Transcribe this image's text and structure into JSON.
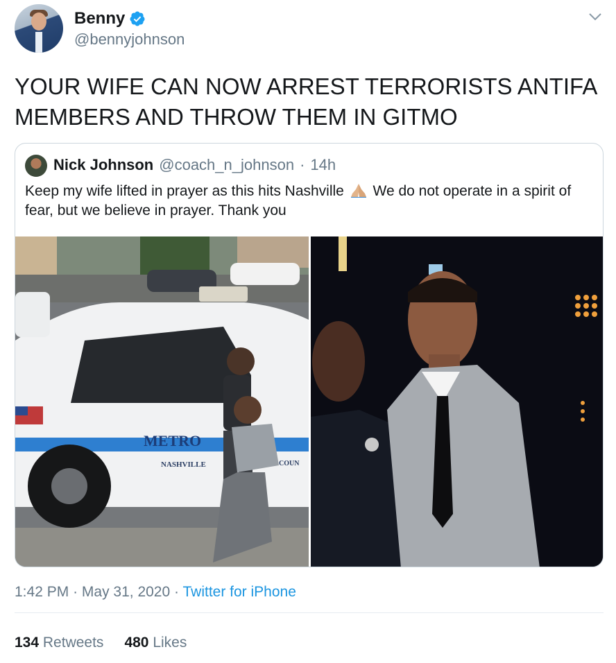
{
  "author": {
    "display_name": "Benny",
    "handle": "@bennyjohnson",
    "verified": true,
    "avatar_icon": "profile-photo"
  },
  "tweet": {
    "text": "YOUR WIFE CAN NOW ARREST TERRORISTS ANTIFA MEMBERS AND THROW THEM IN GITMO"
  },
  "quoted_tweet": {
    "display_name": "Nick Johnson",
    "handle": "@coach_n_johnson",
    "separator": "·",
    "time": "14h",
    "text_before_emoji": "Keep my wife lifted in prayer as this hits Nashville ",
    "emoji": "folded-hands",
    "text_after_emoji": " We do not operate in a spirit of fear, but we believe in prayer. Thank you",
    "photos": [
      "police-car-with-children-photo",
      "couple-portrait-photo"
    ],
    "photo_text": {
      "car_badge": "METRO",
      "car_city": "NASHVILLE",
      "car_county": "COUN"
    }
  },
  "meta": {
    "time": "1:42 PM",
    "separator": "·",
    "date": "May 31, 2020",
    "source": "Twitter for iPhone"
  },
  "stats": {
    "retweets_count": "134",
    "retweets_label": "Retweets",
    "likes_count": "480",
    "likes_label": "Likes"
  },
  "colors": {
    "link_blue": "#1b95e0",
    "secondary_text": "#657786",
    "border": "#ccd6dd",
    "verified_blue": "#1da1f2"
  }
}
